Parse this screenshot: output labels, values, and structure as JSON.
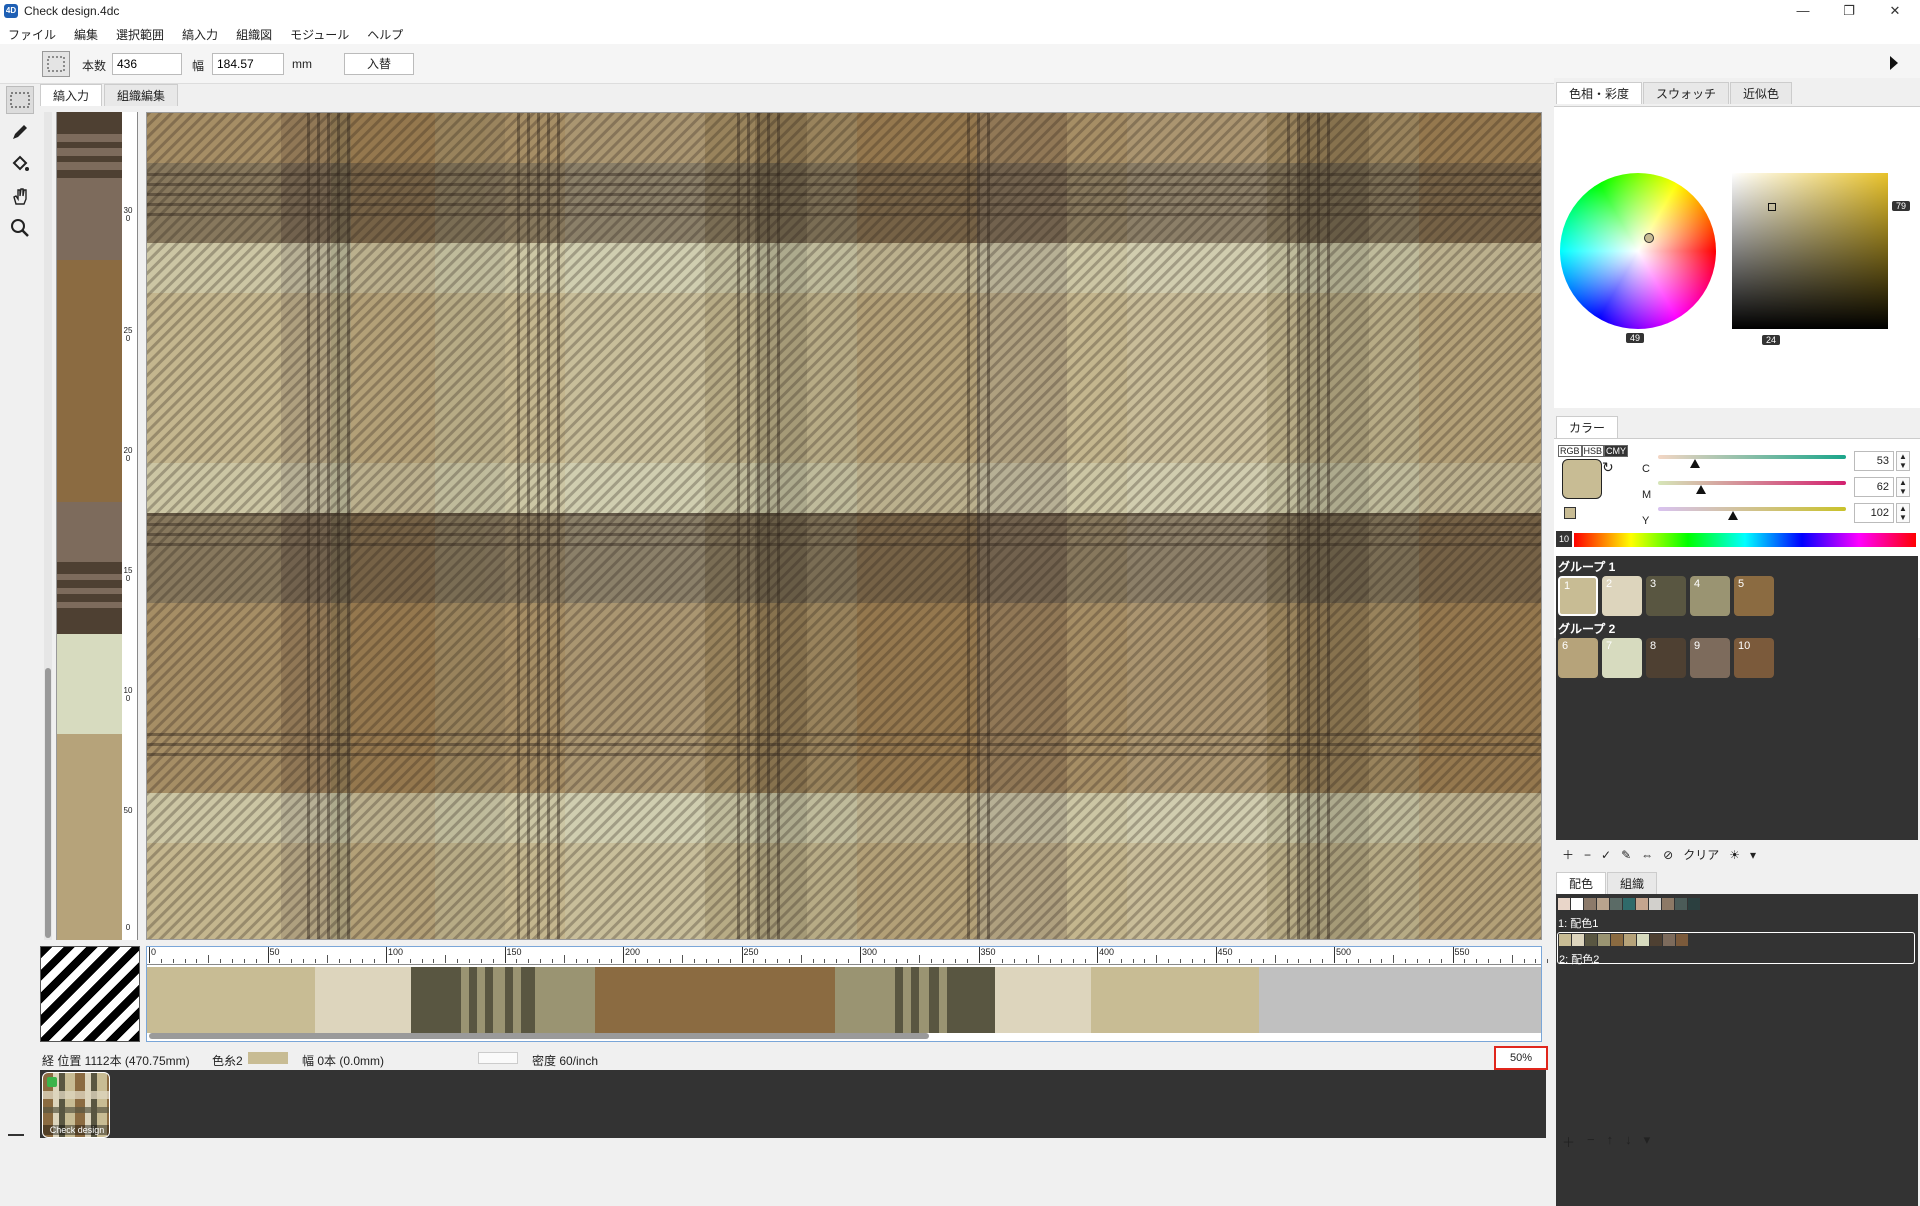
{
  "window": {
    "title": "Check design.4dc",
    "minimize": "—",
    "maximize": "❐",
    "close": "✕"
  },
  "menu": [
    "ファイル",
    "編集",
    "選択範囲",
    "縞入力",
    "組織図",
    "モジュール",
    "ヘルプ"
  ],
  "optionbar": {
    "count_label": "本数",
    "count_value": "436",
    "width_label": "幅",
    "width_value": "184.57",
    "unit": "mm",
    "swap_button": "入替"
  },
  "tools": [
    "select-rect-icon",
    "pencil-icon",
    "paint-bucket-icon",
    "hand-icon",
    "zoom-icon"
  ],
  "main_tabs": [
    {
      "label": "縞入力",
      "active": true
    },
    {
      "label": "組織編集",
      "active": false
    }
  ],
  "vertical_ruler_labels": [
    "300",
    "250",
    "200",
    "150",
    "100",
    "50",
    "0"
  ],
  "horizontal_ruler_labels": [
    "0",
    "50",
    "100",
    "150",
    "200",
    "250",
    "300",
    "350",
    "400",
    "450",
    "500",
    "550"
  ],
  "status": {
    "position": "経  位置 1112本 (470.75mm)",
    "color_label": "色糸2",
    "width": "幅 0本 (0.0mm)",
    "density": "密度 60/inch",
    "zoom": "50%"
  },
  "thumbnail": {
    "label": "Check design"
  },
  "right_panel": {
    "tabs": [
      {
        "label": "色相・彩度",
        "active": true
      },
      {
        "label": "スウォッチ",
        "active": false
      },
      {
        "label": "近似色",
        "active": false
      }
    ],
    "hue_value": "49",
    "sat_value": "79",
    "bri_value": "24",
    "color_tab": "カラー",
    "modes": [
      "RGB",
      "HSB",
      "CMY"
    ],
    "active_mode": "CMY",
    "sliders": [
      {
        "label": "C",
        "value": "53"
      },
      {
        "label": "M",
        "value": "62"
      },
      {
        "label": "Y",
        "value": "102"
      }
    ],
    "spectrum_label": "10",
    "groups": [
      {
        "name": "グループ 1",
        "swatches": [
          {
            "n": "1",
            "color": "#c8bc94"
          },
          {
            "n": "2",
            "color": "#ddd5bd"
          },
          {
            "n": "3",
            "color": "#595641"
          },
          {
            "n": "4",
            "color": "#9a9472"
          },
          {
            "n": "5",
            "color": "#8b6b41"
          }
        ]
      },
      {
        "name": "グループ 2",
        "swatches": [
          {
            "n": "6",
            "color": "#b6a37a"
          },
          {
            "n": "7",
            "color": "#d7dbbf"
          },
          {
            "n": "8",
            "color": "#4e4032"
          },
          {
            "n": "9",
            "color": "#7d6b5c"
          },
          {
            "n": "10",
            "color": "#7b5a3b"
          }
        ]
      }
    ],
    "group_clear": "クリア",
    "bottom_tabs": [
      {
        "label": "配色",
        "active": true
      },
      {
        "label": "組織",
        "active": false
      }
    ],
    "colorways": [
      {
        "label": "1: 配色1",
        "colors": [
          "#e9d6c9",
          "#ffffff",
          "#8c7a6a",
          "#b9a48e",
          "#5b6b66",
          "#2f6a6a",
          "#c4a58f",
          "#d2d0cc",
          "#8d7966",
          "#4b5b58",
          "#2b3f3f"
        ]
      },
      {
        "label": "2: 配色2",
        "colors": [
          "#c8bc94",
          "#ddd5bd",
          "#595641",
          "#9a9472",
          "#8b6b41",
          "#b6a37a",
          "#d7dbbf",
          "#4e4032",
          "#7d6b5c",
          "#7b5a3b"
        ]
      }
    ]
  }
}
